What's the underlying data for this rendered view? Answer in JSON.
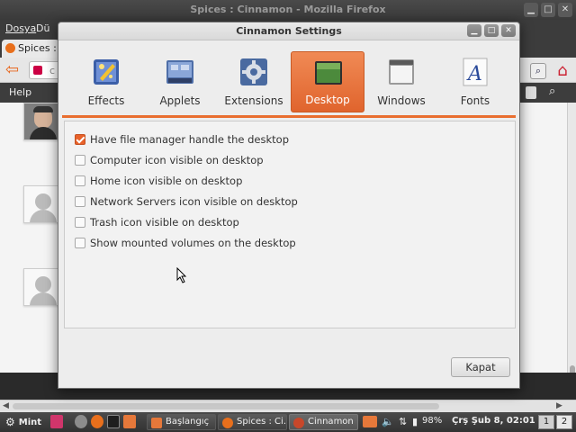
{
  "firefox": {
    "window_title": "Spices : Cinnamon - Mozilla Firefox",
    "menu": [
      "Dosya",
      "Dü"
    ],
    "tab_label": "Spices : C",
    "url_fragment": "c",
    "help_label": "Help"
  },
  "dialog": {
    "title": "Cinnamon Settings",
    "window_buttons": {
      "minimize": "▁",
      "maximize": "□",
      "close": "✕"
    },
    "toolbar": [
      {
        "label": "Effects",
        "icon": "effects-icon",
        "active": false
      },
      {
        "label": "Applets",
        "icon": "applets-icon",
        "active": false
      },
      {
        "label": "Extensions",
        "icon": "extensions-icon",
        "active": false
      },
      {
        "label": "Desktop",
        "icon": "desktop-icon",
        "active": true
      },
      {
        "label": "Windows",
        "icon": "windows-icon",
        "active": false
      },
      {
        "label": "Fonts",
        "icon": "fonts-icon",
        "active": false
      }
    ],
    "options": [
      {
        "label": "Have file manager handle the desktop",
        "checked": true
      },
      {
        "label": "Computer icon visible on desktop",
        "checked": false
      },
      {
        "label": "Home icon visible on desktop",
        "checked": false
      },
      {
        "label": "Network Servers icon visible on desktop",
        "checked": false
      },
      {
        "label": "Trash icon visible on desktop",
        "checked": false
      },
      {
        "label": "Show mounted volumes on the desktop",
        "checked": false
      }
    ],
    "close_label": "Kapat",
    "accent_color": "#e96e2f"
  },
  "panel": {
    "menu_label": "Mint",
    "tasks": [
      {
        "label": "Başlangıç",
        "active": false
      },
      {
        "label": "Spices : Ci...",
        "active": false
      },
      {
        "label": "Cinnamon ...",
        "active": true
      }
    ],
    "battery": "98%",
    "clock": "Çrş Şub  8, 02:01",
    "workspaces": [
      "1",
      "2"
    ]
  }
}
